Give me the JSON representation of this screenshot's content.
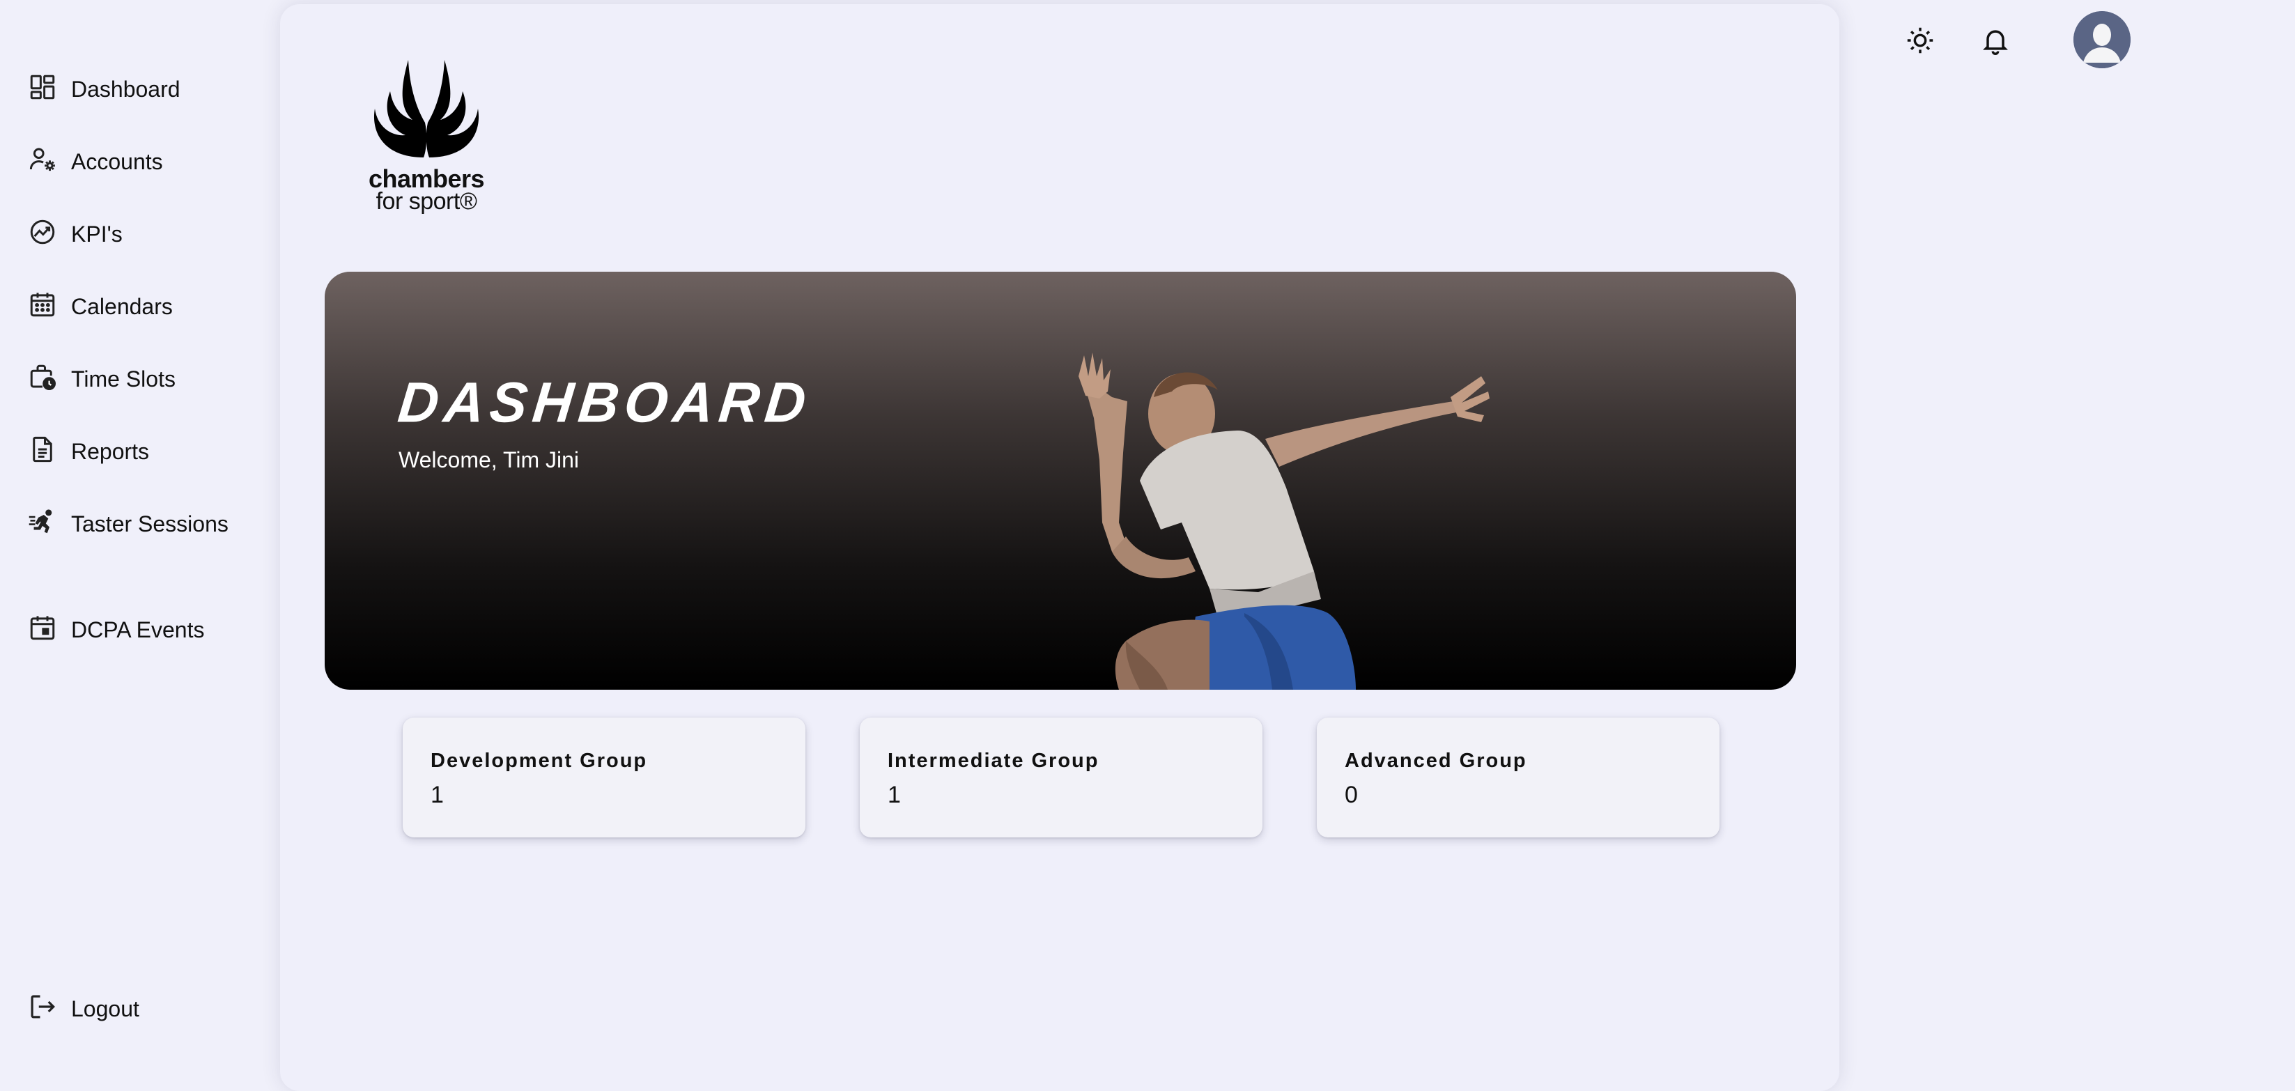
{
  "sidebar": {
    "items": [
      {
        "label": "Dashboard",
        "icon": "dashboard-icon"
      },
      {
        "label": "Accounts",
        "icon": "user-gear-icon"
      },
      {
        "label": "KPI's",
        "icon": "trend-circle-icon"
      },
      {
        "label": "Calendars",
        "icon": "calendar-icon"
      },
      {
        "label": "Time Slots",
        "icon": "briefcase-clock-icon"
      },
      {
        "label": "Reports",
        "icon": "document-icon"
      },
      {
        "label": "Taster Sessions",
        "icon": "runner-icon"
      },
      {
        "label": "DCPA Events",
        "icon": "calendar-event-icon"
      }
    ],
    "logout": {
      "label": "Logout",
      "icon": "logout-icon"
    }
  },
  "logo": {
    "line1": "chambers",
    "line2": "for sport®"
  },
  "hero": {
    "title": "DASHBOARD",
    "subtitle": "Welcome, Tim Jini"
  },
  "cards": [
    {
      "title": "Development Group",
      "value": "1"
    },
    {
      "title": "Intermediate Group",
      "value": "1"
    },
    {
      "title": "Advanced Group",
      "value": "0"
    }
  ],
  "topbar": {
    "theme_icon": "sun-icon",
    "notifications_icon": "bell-icon",
    "avatar_icon": "avatar-icon"
  },
  "colors": {
    "background": "#f0f0fa",
    "panel": "#efeffa",
    "hero_top": "#6e6260",
    "hero_bottom": "#000000",
    "avatar": "#5a6585"
  }
}
